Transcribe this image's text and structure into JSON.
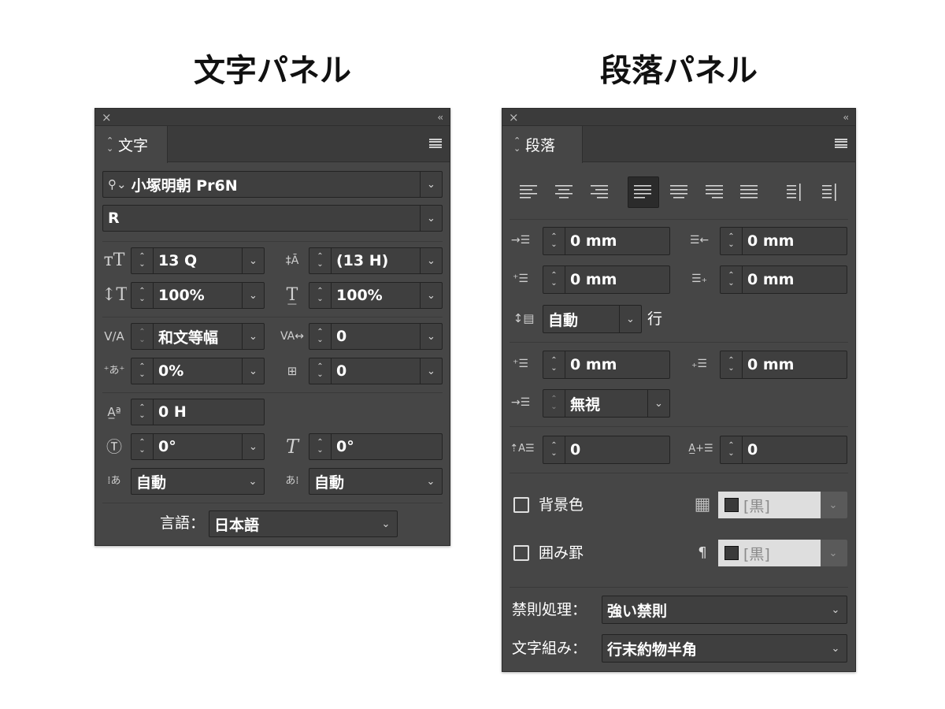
{
  "headings": {
    "character": "文字パネル",
    "paragraph": "段落パネル"
  },
  "character_panel": {
    "close_glyph": "×",
    "collapse_glyph": "‹‹",
    "tab_label": "文字",
    "font_family": "小塚明朝 Pr6N",
    "font_style": "R",
    "font_size": "13 Q",
    "leading": "(13 H)",
    "vertical_scale": "100%",
    "horizontal_scale": "100%",
    "kerning": "和文等幅",
    "tracking": "0",
    "tsume": "0%",
    "aki": "0",
    "baseline_shift": "0 H",
    "character_rotation": "0°",
    "skew": "0°",
    "aki_before": "自動",
    "aki_after": "自動",
    "language_label": "言語：",
    "language": "日本語"
  },
  "paragraph_panel": {
    "close_glyph": "×",
    "collapse_glyph": "‹‹",
    "tab_label": "段落",
    "alignment_buttons": [
      "align-left",
      "align-center",
      "align-right",
      "justify-left",
      "justify-center",
      "justify-right",
      "justify-all",
      "align-toward-spine",
      "align-away-spine"
    ],
    "active_alignment": "justify-left",
    "left_indent": "0 mm",
    "right_indent": "0 mm",
    "first_line_indent": "0 mm",
    "last_line_right_indent": "0 mm",
    "grid_alignment": "自動",
    "grid_unit_label": "行",
    "space_before": "0 mm",
    "space_after": "0 mm",
    "span_setting": "無視",
    "drop_cap_lines": "0",
    "drop_cap_chars": "0",
    "shading_label": "背景色",
    "shading_swatch": "[黒]",
    "border_label": "囲み罫",
    "border_swatch": "[黒]",
    "kinsoku_label": "禁則処理：",
    "kinsoku": "強い禁則",
    "mojikumi_label": "文字組み：",
    "mojikumi": "行末約物半角"
  }
}
